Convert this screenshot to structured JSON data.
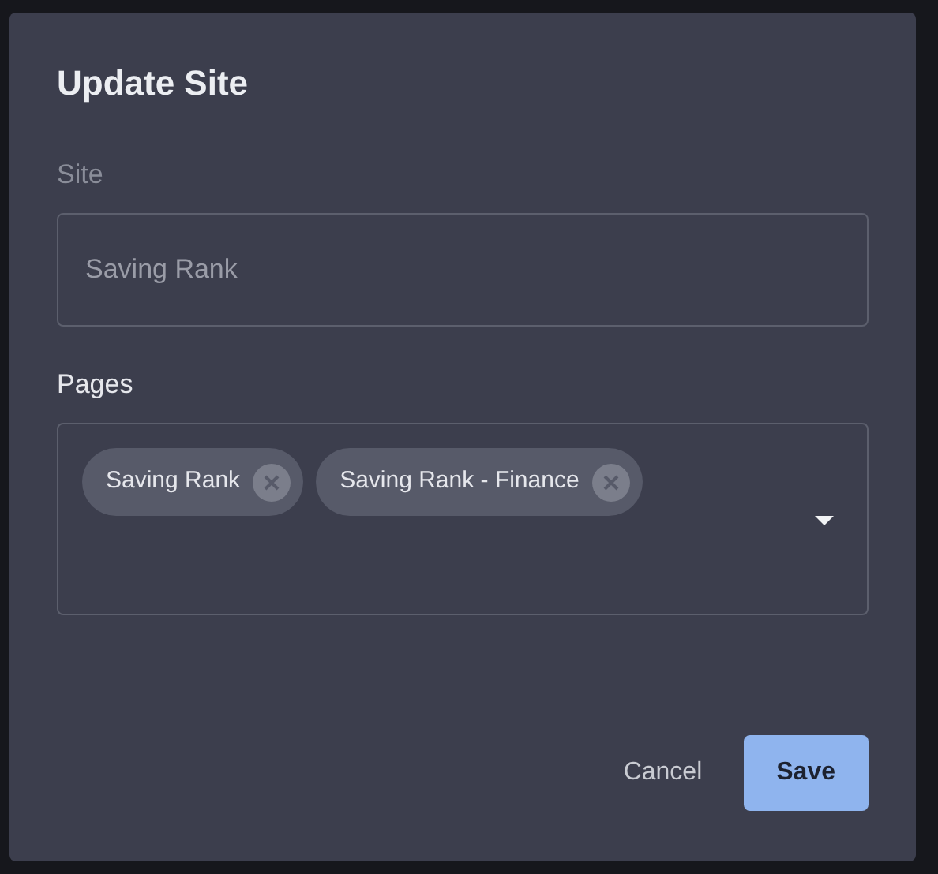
{
  "dialog": {
    "title": "Update Site",
    "site": {
      "label": "Site",
      "value": "Saving Rank",
      "disabled": true
    },
    "pages": {
      "label": "Pages",
      "chips": [
        {
          "label": "Saving Rank"
        },
        {
          "label": "Saving Rank - Finance"
        }
      ]
    },
    "buttons": [
      {
        "label": "Cancel",
        "kind": "text"
      },
      {
        "label": "Save",
        "kind": "primary"
      }
    ]
  }
}
